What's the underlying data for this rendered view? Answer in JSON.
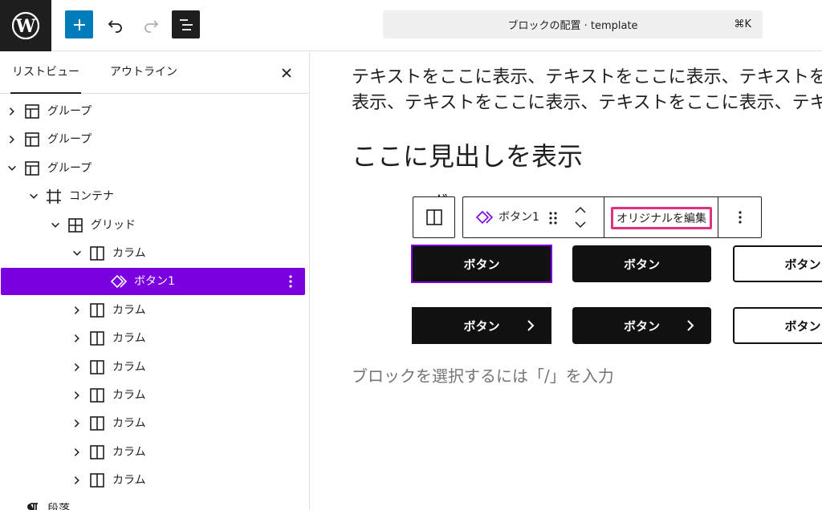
{
  "header": {
    "command_bar": "ブロックの配置 · template",
    "command_shortcut": "⌘K"
  },
  "sidebar": {
    "tabs": [
      {
        "label": "リストビュー",
        "active": true
      },
      {
        "label": "アウトライン",
        "active": false
      }
    ],
    "tree": [
      {
        "label": "グループ",
        "icon": "group-icon",
        "depth": 0,
        "chevron": "right"
      },
      {
        "label": "グループ",
        "icon": "group-icon",
        "depth": 0,
        "chevron": "right"
      },
      {
        "label": "グループ",
        "icon": "group-icon",
        "depth": 0,
        "chevron": "down"
      },
      {
        "label": "コンテナ",
        "icon": "container-icon",
        "depth": 1,
        "chevron": "down"
      },
      {
        "label": "グリッド",
        "icon": "grid-icon",
        "depth": 2,
        "chevron": "down"
      },
      {
        "label": "カラム",
        "icon": "column-icon",
        "depth": 3,
        "chevron": "down"
      },
      {
        "label": "ボタン1",
        "icon": "pattern-icon",
        "depth": 4,
        "chevron": "none",
        "selected": true
      },
      {
        "label": "カラム",
        "icon": "column-icon",
        "depth": 3,
        "chevron": "right"
      },
      {
        "label": "カラム",
        "icon": "column-icon",
        "depth": 3,
        "chevron": "right"
      },
      {
        "label": "カラム",
        "icon": "column-icon",
        "depth": 3,
        "chevron": "right"
      },
      {
        "label": "カラム",
        "icon": "column-icon",
        "depth": 3,
        "chevron": "right"
      },
      {
        "label": "カラム",
        "icon": "column-icon",
        "depth": 3,
        "chevron": "right"
      },
      {
        "label": "カラム",
        "icon": "column-icon",
        "depth": 3,
        "chevron": "right"
      },
      {
        "label": "カラム",
        "icon": "column-icon",
        "depth": 3,
        "chevron": "right"
      },
      {
        "label": "段落",
        "icon": "paragraph-icon",
        "depth": 0,
        "chevron": "none"
      }
    ]
  },
  "canvas": {
    "paragraph_line1": "テキストをここに表示、テキストをここに表示、テキストをここに",
    "paragraph_line2": "表示、テキストをここに表示、テキストをここに表示、テキストを",
    "heading": "ここに見出しを表示",
    "hidden_heading_peek": "ボ",
    "placeholder": "ブロックを選択するには「/」を入力",
    "toolbar": {
      "block_label": "ボタン1",
      "edit_original": "オリジナルを編集"
    },
    "buttons": {
      "row1": [
        "ボタン",
        "ボタン",
        "ボタン"
      ],
      "row2": [
        "ボタン",
        "ボタン",
        "ボタン"
      ]
    }
  },
  "colors": {
    "accent": "#007cba",
    "selected": "#7a00df",
    "highlight": "#e0317f",
    "dark": "#1e1e1e"
  }
}
